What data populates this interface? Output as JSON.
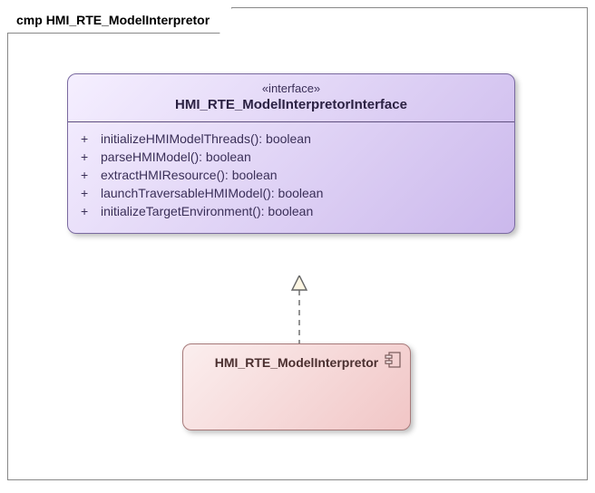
{
  "frame": {
    "keyword": "cmp",
    "name": "HMI_RTE_ModelInterpretor"
  },
  "interface": {
    "stereotype": "«interface»",
    "name": "HMI_RTE_ModelInterpretorInterface",
    "operations": [
      {
        "visibility": "+",
        "signature": "initializeHMIModelThreads(): boolean"
      },
      {
        "visibility": "+",
        "signature": "parseHMIModel(): boolean"
      },
      {
        "visibility": "+",
        "signature": "extractHMIResource(): boolean"
      },
      {
        "visibility": "+",
        "signature": "launchTraversableHMIModel(): boolean"
      },
      {
        "visibility": "+",
        "signature": "initializeTargetEnvironment(): boolean"
      }
    ]
  },
  "component": {
    "name": "HMI_RTE_ModelInterpretor"
  }
}
